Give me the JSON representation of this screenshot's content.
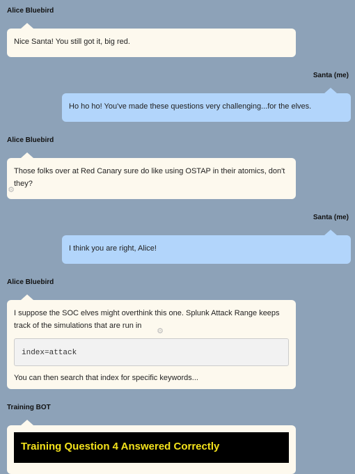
{
  "messages": [
    {
      "sender": "Alice Bluebird",
      "text": "Nice Santa! You still got it, big red."
    },
    {
      "sender": "Santa (me)",
      "text": "Ho ho ho! You've made these questions very challenging...for the elves."
    },
    {
      "sender": "Alice Bluebird",
      "text": "Those folks over at Red Canary sure do like using OSTAP in their atomics, don't they?"
    },
    {
      "sender": "Santa (me)",
      "text": "I think you are right, Alice!"
    },
    {
      "sender": "Alice Bluebird",
      "text": "I suppose the SOC elves might overthink this one. Splunk Attack Range keeps track of the simulations that are run in",
      "code": "index=attack",
      "after": "You can then search that index for specific keywords..."
    },
    {
      "sender": "Training BOT",
      "banner": "Training Question 4 Answered Correctly"
    }
  ],
  "icons": {
    "loading": "gear-icon"
  },
  "colors": {
    "background": "#8da2b8",
    "bubble_other": "#fdf9ee",
    "bubble_me": "#b2d5fb",
    "banner_text": "#f3e21b"
  }
}
